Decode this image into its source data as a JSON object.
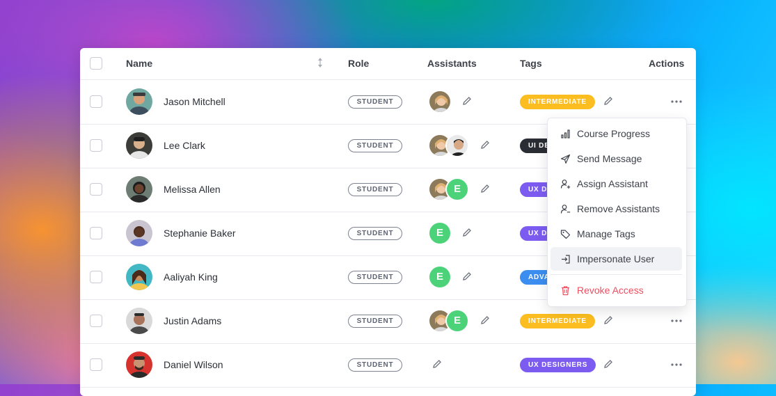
{
  "table": {
    "headers": {
      "name": "Name",
      "role": "Role",
      "assistants": "Assistants",
      "tags": "Tags",
      "actions": "Actions"
    },
    "rows": [
      {
        "name": "Jason Mitchell",
        "role": "STUDENT",
        "tag": "INTERMEDIATE",
        "tag_color": "#fbbd1f"
      },
      {
        "name": "Lee Clark",
        "role": "STUDENT",
        "tag": "UI DESIGNERS",
        "tag_color": "#2a2d33"
      },
      {
        "name": "Melissa Allen",
        "role": "STUDENT",
        "tag": "UX DESIGNERS",
        "tag_color": "#7c5cf0"
      },
      {
        "name": "Stephanie Baker",
        "role": "STUDENT",
        "tag": "UX DESIGNERS",
        "tag_color": "#7c5cf0"
      },
      {
        "name": "Aaliyah King",
        "role": "STUDENT",
        "tag": "ADVANCED",
        "tag_color": "#3b8ef0"
      },
      {
        "name": "Justin Adams",
        "role": "STUDENT",
        "tag": "INTERMEDIATE",
        "tag_color": "#fbbd1f"
      },
      {
        "name": "Daniel Wilson",
        "role": "STUDENT",
        "tag": "UX DESIGNERS",
        "tag_color": "#7c5cf0"
      }
    ],
    "assistant_initial": "E"
  },
  "action_menu": {
    "items": [
      {
        "label": "Course Progress",
        "icon": "bar-chart-icon"
      },
      {
        "label": "Send Message",
        "icon": "send-icon"
      },
      {
        "label": "Assign Assistant",
        "icon": "user-plus-icon"
      },
      {
        "label": "Remove Assistants",
        "icon": "user-minus-icon"
      },
      {
        "label": "Manage Tags",
        "icon": "tag-icon"
      },
      {
        "label": "Impersonate User",
        "icon": "sign-in-icon"
      }
    ],
    "danger_item": {
      "label": "Revoke Access",
      "icon": "trash-icon",
      "color": "#ef4d5f"
    }
  },
  "colors": {
    "accent_green": "#4cd37a",
    "danger": "#ef4d5f"
  }
}
